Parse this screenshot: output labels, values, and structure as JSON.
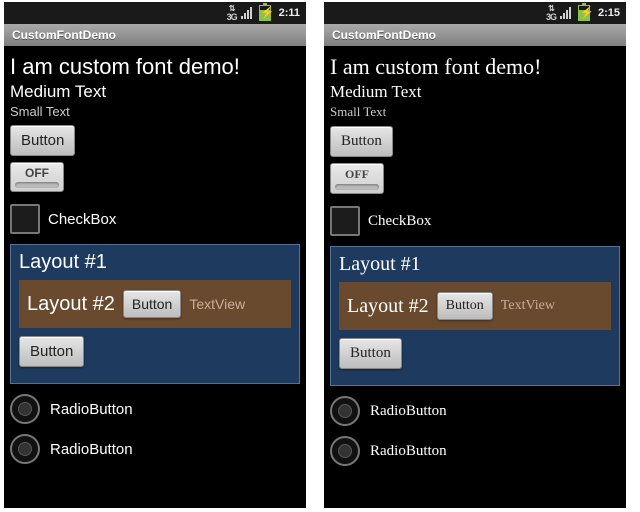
{
  "phones": [
    {
      "style": "sans",
      "status": {
        "network": "3G",
        "clock": "2:11"
      },
      "title": "CustomFontDemo",
      "headline": "I am custom font demo!",
      "medium": "Medium Text",
      "small": "Small Text",
      "button1": "Button",
      "toggle": "OFF",
      "checkbox": "CheckBox",
      "layout1_title": "Layout #1",
      "layout2_title": "Layout #2",
      "layout2_button": "Button",
      "layout2_textview": "TextView",
      "layout1_button": "Button",
      "radio1": "RadioButton",
      "radio2": "RadioButton"
    },
    {
      "style": "serif",
      "status": {
        "network": "3G",
        "clock": "2:15"
      },
      "title": "CustomFontDemo",
      "headline": "I am custom font demo!",
      "medium": "Medium Text",
      "small": "Small Text",
      "button1": "Button",
      "toggle": "OFF",
      "checkbox": "CheckBox",
      "layout1_title": "Layout #1",
      "layout2_title": "Layout #2",
      "layout2_button": "Button",
      "layout2_textview": "TextView",
      "layout1_button": "Button",
      "radio1": "RadioButton",
      "radio2": "RadioButton"
    }
  ]
}
